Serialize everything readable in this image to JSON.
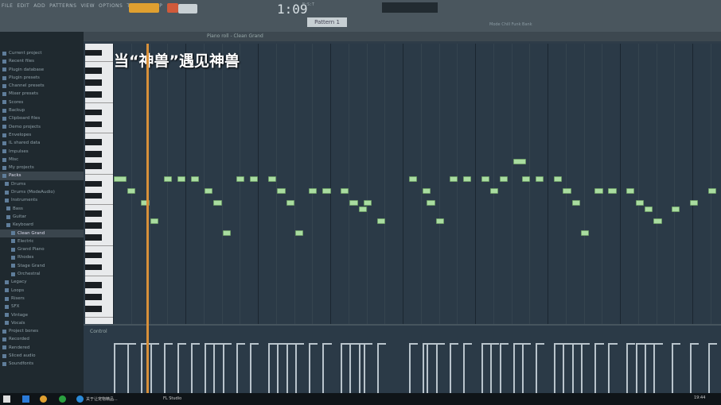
{
  "menu": [
    "FILE",
    "EDIT",
    "ADD",
    "PATTERNS",
    "VIEW",
    "OPTIONS",
    "TOOLS",
    "HELP"
  ],
  "transport": {
    "time": "1:09",
    "time_unit": "B:S:T",
    "tempo_label": "Pattern 1"
  },
  "hint": "Piano roll - Clean Grand",
  "toolbar_extra": "Mode  Chill Funk Bank",
  "sidebar": [
    "Current project",
    "Recent files",
    "Plugin database",
    "Plugin presets",
    "Channel presets",
    "Mixer presets",
    "Scores",
    "Backup",
    "Clipboard files",
    "Demo projects",
    "Envelopes",
    "IL shared data",
    "Impulses",
    "Misc",
    "My projects",
    "Packs",
    "Drums",
    "Drums (ModeAudio)",
    "Instruments",
    "Bass",
    "Guitar",
    "Keyboard",
    "Clean Grand",
    "Electric",
    "Grand Piano",
    "Rhodes",
    "Stage Grand",
    "Orchestral",
    "Legacy",
    "Loops",
    "Risers",
    "SFX",
    "Vintage",
    "Vocals",
    "Project bones",
    "Recorded",
    "Rendered",
    "Sliced audio",
    "Soundfonts"
  ],
  "sidebar_selected": [
    "Packs",
    "Clean Grand"
  ],
  "overlay_title": "当“神兽”遇见神兽",
  "control_label": "Control",
  "taskbar": {
    "app1": "关于让宠物精品...",
    "app2": "FL Studio",
    "clock": "19:44"
  },
  "colors": {
    "note": "#a9dca0",
    "playhead": "#d8903a",
    "grid": "#2b3a47"
  },
  "playhead_step": 7.5,
  "notes": [
    [
      0,
      76,
      3
    ],
    [
      3,
      74,
      2
    ],
    [
      6,
      72,
      2
    ],
    [
      8,
      69,
      2
    ],
    [
      11,
      76,
      2
    ],
    [
      14,
      76,
      2
    ],
    [
      17,
      76,
      2
    ],
    [
      20,
      74,
      2
    ],
    [
      22,
      72,
      2
    ],
    [
      24,
      67,
      2
    ],
    [
      27,
      76,
      2
    ],
    [
      30,
      76,
      2
    ],
    [
      34,
      76,
      2
    ],
    [
      36,
      74,
      2
    ],
    [
      38,
      72,
      2
    ],
    [
      40,
      67,
      2
    ],
    [
      43,
      74,
      2
    ],
    [
      46,
      74,
      2
    ],
    [
      50,
      74,
      2
    ],
    [
      52,
      72,
      2
    ],
    [
      54,
      71,
      2
    ],
    [
      55,
      72,
      2
    ],
    [
      58,
      69,
      2
    ],
    [
      65,
      76,
      2
    ],
    [
      68,
      74,
      2
    ],
    [
      69,
      72,
      2
    ],
    [
      71,
      69,
      2
    ],
    [
      74,
      76,
      2
    ],
    [
      77,
      76,
      2
    ],
    [
      81,
      76,
      2
    ],
    [
      83,
      74,
      2
    ],
    [
      85,
      76,
      2
    ],
    [
      88,
      79,
      3
    ],
    [
      90,
      76,
      2
    ],
    [
      93,
      76,
      2
    ],
    [
      97,
      76,
      2
    ],
    [
      99,
      74,
      2
    ],
    [
      101,
      72,
      2
    ],
    [
      103,
      67,
      2
    ],
    [
      106,
      74,
      2
    ],
    [
      109,
      74,
      2
    ],
    [
      113,
      74,
      2
    ],
    [
      115,
      72,
      2
    ],
    [
      117,
      71,
      2
    ],
    [
      119,
      69,
      2
    ],
    [
      123,
      71,
      2
    ],
    [
      127,
      72,
      2
    ],
    [
      131,
      74,
      2
    ]
  ]
}
